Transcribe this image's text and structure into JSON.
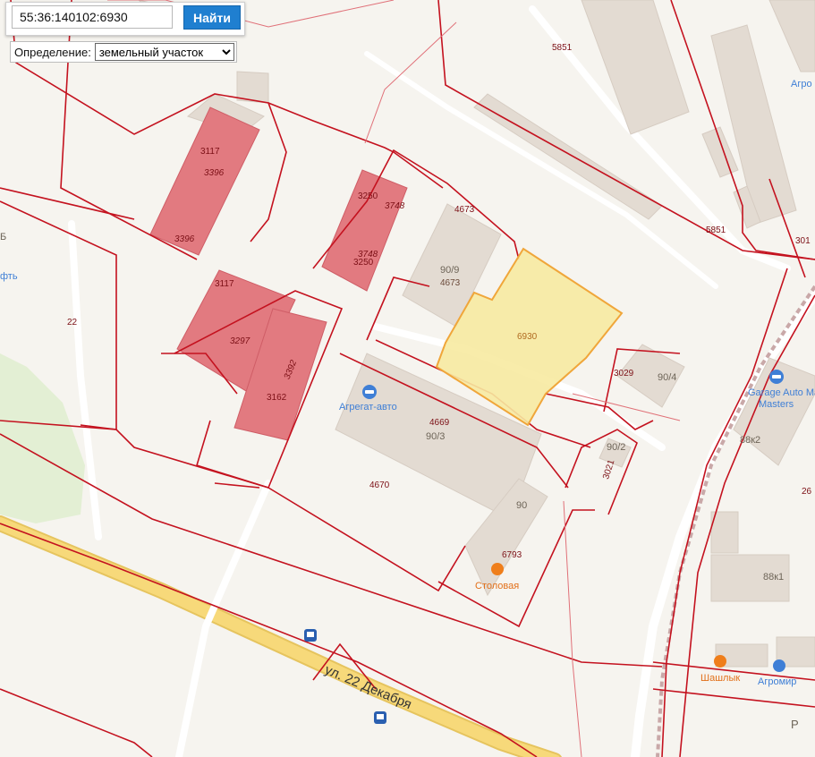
{
  "search": {
    "value": "55:36:140102:6930",
    "button_label": "Найти"
  },
  "definition": {
    "label": "Определение:",
    "options": [
      "земельный участок"
    ],
    "selected": "земельный участок"
  },
  "map": {
    "street_name": "ул. 22 Декабря",
    "selected_parcel": {
      "number": "6930",
      "fill": "#f7eaa1",
      "stroke": "#f0a63a"
    },
    "colors": {
      "parcel_border": "#c4121f",
      "building": "#e3dbd2",
      "registered_building": "#e27a80",
      "road": "#f7d97a"
    },
    "parcel_numbers": [
      "5851",
      "5851",
      "301",
      "4673",
      "4673",
      "3250",
      "3748",
      "3748",
      "3250",
      "3117",
      "3396",
      "3396",
      "3117",
      "3297",
      "3392",
      "3162",
      "4669",
      "4670",
      "3029",
      "3021",
      "6793",
      "22",
      "26"
    ],
    "building_labels": [
      "90/9",
      "90/3",
      "90/4",
      "90/2",
      "90",
      "88к2",
      "88к1",
      "Б",
      "P"
    ],
    "pois": [
      {
        "name": "Агрегат-авто",
        "icon": "car-icon",
        "color": "#3f7fd6"
      },
      {
        "name": "Garage Auto Masters",
        "icon": "car-icon",
        "color": "#3f7fd6"
      },
      {
        "name": "Столовая",
        "icon": "cafe-icon",
        "color": "#ef7e1b"
      },
      {
        "name": "Шашлык",
        "icon": "cafe-icon",
        "color": "#ef7e1b"
      },
      {
        "name": "Агромир",
        "icon": "basket-icon",
        "color": "#3f7fd6"
      }
    ],
    "edge_labels": [
      "Агро",
      "фть"
    ]
  }
}
